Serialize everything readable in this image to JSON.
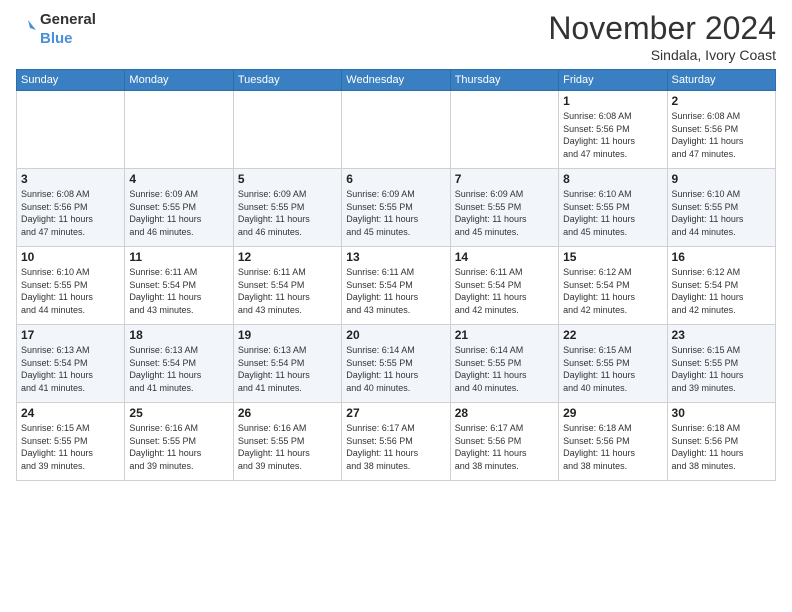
{
  "logo": {
    "line1": "General",
    "line2": "Blue"
  },
  "title": "November 2024",
  "location": "Sindala, Ivory Coast",
  "days_header": [
    "Sunday",
    "Monday",
    "Tuesday",
    "Wednesday",
    "Thursday",
    "Friday",
    "Saturday"
  ],
  "weeks": [
    [
      {
        "day": "",
        "info": ""
      },
      {
        "day": "",
        "info": ""
      },
      {
        "day": "",
        "info": ""
      },
      {
        "day": "",
        "info": ""
      },
      {
        "day": "",
        "info": ""
      },
      {
        "day": "1",
        "info": "Sunrise: 6:08 AM\nSunset: 5:56 PM\nDaylight: 11 hours\nand 47 minutes."
      },
      {
        "day": "2",
        "info": "Sunrise: 6:08 AM\nSunset: 5:56 PM\nDaylight: 11 hours\nand 47 minutes."
      }
    ],
    [
      {
        "day": "3",
        "info": "Sunrise: 6:08 AM\nSunset: 5:56 PM\nDaylight: 11 hours\nand 47 minutes."
      },
      {
        "day": "4",
        "info": "Sunrise: 6:09 AM\nSunset: 5:55 PM\nDaylight: 11 hours\nand 46 minutes."
      },
      {
        "day": "5",
        "info": "Sunrise: 6:09 AM\nSunset: 5:55 PM\nDaylight: 11 hours\nand 46 minutes."
      },
      {
        "day": "6",
        "info": "Sunrise: 6:09 AM\nSunset: 5:55 PM\nDaylight: 11 hours\nand 45 minutes."
      },
      {
        "day": "7",
        "info": "Sunrise: 6:09 AM\nSunset: 5:55 PM\nDaylight: 11 hours\nand 45 minutes."
      },
      {
        "day": "8",
        "info": "Sunrise: 6:10 AM\nSunset: 5:55 PM\nDaylight: 11 hours\nand 45 minutes."
      },
      {
        "day": "9",
        "info": "Sunrise: 6:10 AM\nSunset: 5:55 PM\nDaylight: 11 hours\nand 44 minutes."
      }
    ],
    [
      {
        "day": "10",
        "info": "Sunrise: 6:10 AM\nSunset: 5:55 PM\nDaylight: 11 hours\nand 44 minutes."
      },
      {
        "day": "11",
        "info": "Sunrise: 6:11 AM\nSunset: 5:54 PM\nDaylight: 11 hours\nand 43 minutes."
      },
      {
        "day": "12",
        "info": "Sunrise: 6:11 AM\nSunset: 5:54 PM\nDaylight: 11 hours\nand 43 minutes."
      },
      {
        "day": "13",
        "info": "Sunrise: 6:11 AM\nSunset: 5:54 PM\nDaylight: 11 hours\nand 43 minutes."
      },
      {
        "day": "14",
        "info": "Sunrise: 6:11 AM\nSunset: 5:54 PM\nDaylight: 11 hours\nand 42 minutes."
      },
      {
        "day": "15",
        "info": "Sunrise: 6:12 AM\nSunset: 5:54 PM\nDaylight: 11 hours\nand 42 minutes."
      },
      {
        "day": "16",
        "info": "Sunrise: 6:12 AM\nSunset: 5:54 PM\nDaylight: 11 hours\nand 42 minutes."
      }
    ],
    [
      {
        "day": "17",
        "info": "Sunrise: 6:13 AM\nSunset: 5:54 PM\nDaylight: 11 hours\nand 41 minutes."
      },
      {
        "day": "18",
        "info": "Sunrise: 6:13 AM\nSunset: 5:54 PM\nDaylight: 11 hours\nand 41 minutes."
      },
      {
        "day": "19",
        "info": "Sunrise: 6:13 AM\nSunset: 5:54 PM\nDaylight: 11 hours\nand 41 minutes."
      },
      {
        "day": "20",
        "info": "Sunrise: 6:14 AM\nSunset: 5:55 PM\nDaylight: 11 hours\nand 40 minutes."
      },
      {
        "day": "21",
        "info": "Sunrise: 6:14 AM\nSunset: 5:55 PM\nDaylight: 11 hours\nand 40 minutes."
      },
      {
        "day": "22",
        "info": "Sunrise: 6:15 AM\nSunset: 5:55 PM\nDaylight: 11 hours\nand 40 minutes."
      },
      {
        "day": "23",
        "info": "Sunrise: 6:15 AM\nSunset: 5:55 PM\nDaylight: 11 hours\nand 39 minutes."
      }
    ],
    [
      {
        "day": "24",
        "info": "Sunrise: 6:15 AM\nSunset: 5:55 PM\nDaylight: 11 hours\nand 39 minutes."
      },
      {
        "day": "25",
        "info": "Sunrise: 6:16 AM\nSunset: 5:55 PM\nDaylight: 11 hours\nand 39 minutes."
      },
      {
        "day": "26",
        "info": "Sunrise: 6:16 AM\nSunset: 5:55 PM\nDaylight: 11 hours\nand 39 minutes."
      },
      {
        "day": "27",
        "info": "Sunrise: 6:17 AM\nSunset: 5:56 PM\nDaylight: 11 hours\nand 38 minutes."
      },
      {
        "day": "28",
        "info": "Sunrise: 6:17 AM\nSunset: 5:56 PM\nDaylight: 11 hours\nand 38 minutes."
      },
      {
        "day": "29",
        "info": "Sunrise: 6:18 AM\nSunset: 5:56 PM\nDaylight: 11 hours\nand 38 minutes."
      },
      {
        "day": "30",
        "info": "Sunrise: 6:18 AM\nSunset: 5:56 PM\nDaylight: 11 hours\nand 38 minutes."
      }
    ]
  ]
}
